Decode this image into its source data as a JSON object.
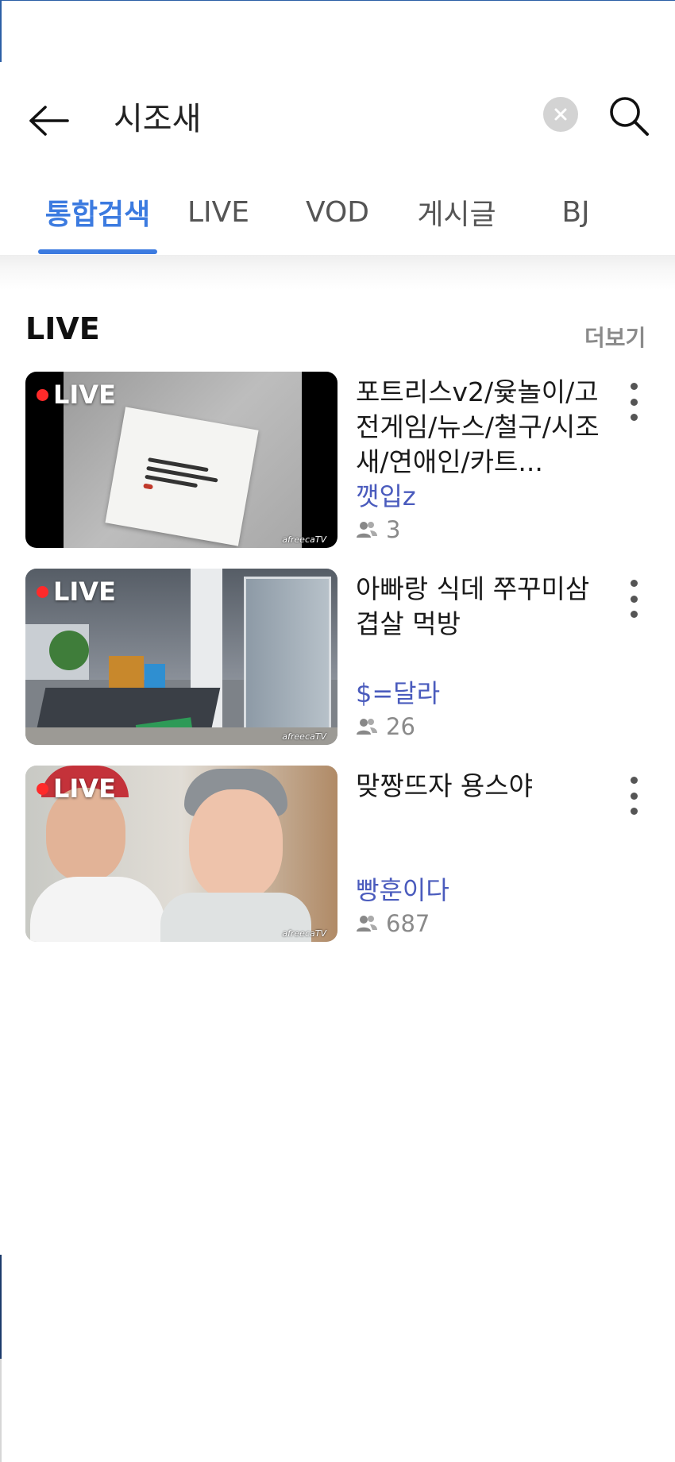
{
  "search": {
    "query": "시조새"
  },
  "tabs": [
    {
      "label": "통합검색",
      "active": true
    },
    {
      "label": "LIVE"
    },
    {
      "label": "VOD"
    },
    {
      "label": "게시글"
    },
    {
      "label": "BJ"
    }
  ],
  "section": {
    "title": "LIVE",
    "more_label": "더보기"
  },
  "live_items": [
    {
      "badge": "LIVE",
      "title": "포트리스v2/윷놀이/고전게임/뉴스/철구/시조새/연애인/카트...",
      "channel": "깻입z",
      "viewers": "3",
      "watermark": "afreecaTV"
    },
    {
      "badge": "LIVE",
      "title": "아빠랑 식데  쭈꾸미삼겹살 먹방",
      "channel": "$=달라",
      "viewers": "26",
      "watermark": "afreecaTV"
    },
    {
      "badge": "LIVE",
      "title": "맞짱뜨자 용스야",
      "channel": "빵훈이다",
      "viewers": "687",
      "watermark": "afreecaTV"
    }
  ],
  "icons": {
    "back": "arrow-left-icon",
    "clear": "clear-icon",
    "search": "search-icon",
    "viewers": "people-icon",
    "more": "more-vertical-icon"
  },
  "colors": {
    "accent": "#3c7be0",
    "channel": "#4a5bbd",
    "live_dot": "#ff2a2a"
  }
}
